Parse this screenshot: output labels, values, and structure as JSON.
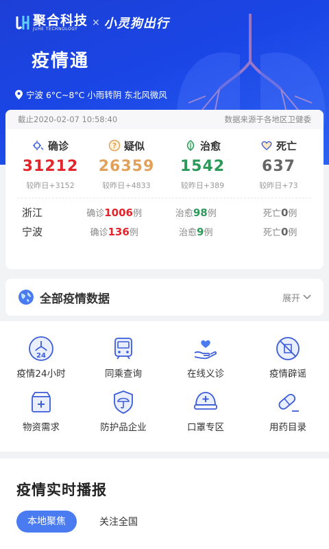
{
  "brand": {
    "name_cn": "聚合科技",
    "name_en": "JUHE TECHNOLOGY",
    "separator": "×",
    "partner": "小灵狗出行"
  },
  "app_title": "疫情通",
  "weather": "宁波 6°C~8°C 小雨转阴 东北风微风",
  "stats_header": {
    "as_of": "截止2020-02-07 10:58:40",
    "source": "数据来源于各地区卫健委"
  },
  "stats": [
    {
      "label": "确诊",
      "value": "31212",
      "delta": "较昨日+3152",
      "color": "#e2242b",
      "icon": "virus-icon"
    },
    {
      "label": "疑似",
      "value": "26359",
      "delta": "较昨日+4833",
      "color": "#e2a15a",
      "icon": "question-icon"
    },
    {
      "label": "治愈",
      "value": "1542",
      "delta": "较昨日+389",
      "color": "#2b9a58",
      "icon": "leaf-icon"
    },
    {
      "label": "死亡",
      "value": "637",
      "delta": "较昨日+73",
      "color": "#666666",
      "icon": "heart-icon"
    }
  ],
  "regions": [
    {
      "name": "浙江",
      "confirmed_pre": "确诊",
      "confirmed": "1006",
      "confirmed_suf": "例",
      "cured_pre": "治愈",
      "cured": "98",
      "cured_suf": "例",
      "dead_pre": "死亡",
      "dead": "0",
      "dead_suf": "例"
    },
    {
      "name": "宁波",
      "confirmed_pre": "确诊",
      "confirmed": "136",
      "confirmed_suf": "例",
      "cured_pre": "治愈",
      "cured": "9",
      "cured_suf": "例",
      "dead_pre": "死亡",
      "dead": "0",
      "dead_suf": "例"
    }
  ],
  "all_data": {
    "title": "全部疫情数据",
    "expand": "展开"
  },
  "grid": [
    {
      "label": "疫情24小时",
      "icon": "lung-24-icon"
    },
    {
      "label": "同乘查询",
      "icon": "train-icon"
    },
    {
      "label": "在线义诊",
      "icon": "hand-heart-icon"
    },
    {
      "label": "疫情辟谣",
      "icon": "rumor-icon"
    },
    {
      "label": "物资需求",
      "icon": "supply-box-icon"
    },
    {
      "label": "防护品企业",
      "icon": "shield-umbrella-icon"
    },
    {
      "label": "口罩专区",
      "icon": "helmet-icon"
    },
    {
      "label": "用药目录",
      "icon": "pill-icon"
    }
  ],
  "feed": {
    "title": "疫情实时播报",
    "tabs": [
      "本地聚焦",
      "关注全国"
    ]
  },
  "colors": {
    "primary": "#1d3fd6",
    "accent_blue": "#4b7bf0",
    "icon_blue": "#3b5bd9"
  }
}
